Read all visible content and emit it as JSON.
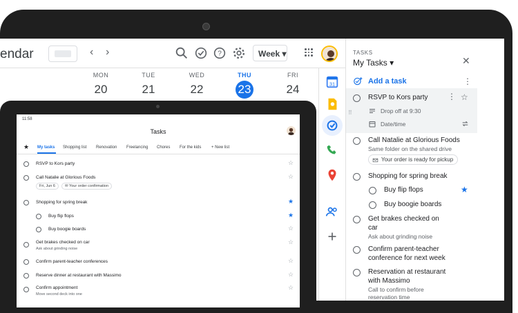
{
  "calendar": {
    "title": "endar",
    "nav_prev": "‹",
    "nav_next": "›",
    "view_select": "Week",
    "days": [
      {
        "name": "MON",
        "date": "20",
        "today": false
      },
      {
        "name": "TUE",
        "date": "21",
        "today": false
      },
      {
        "name": "WED",
        "date": "22",
        "today": false
      },
      {
        "name": "THU",
        "date": "23",
        "today": true
      },
      {
        "name": "FRI",
        "date": "24",
        "today": false
      }
    ]
  },
  "tasks_panel": {
    "label": "TASKS",
    "list_title": "My Tasks ▾",
    "add_task": "Add a task",
    "close": "✕",
    "items": [
      {
        "title": "RSVP to Kors party",
        "detail": "Drop off at 9:30",
        "date_placeholder": "Date/time"
      },
      {
        "title": "Call Natalie at Glorious Foods",
        "detail": "Same folder on the shared drive",
        "chip": "Your order is ready for pickup"
      },
      {
        "title": "Shopping for spring break",
        "subtasks": [
          "Buy flip flops",
          "Buy boogie boards"
        ]
      },
      {
        "title_line1": "Get brakes checked on",
        "title_line2": "car",
        "detail": "Ask about grinding noise"
      },
      {
        "title_line1": "Confirm parent-teacher",
        "title_line2": "conference for next week"
      },
      {
        "title_line1": "Reservation at restaurant",
        "title_line2": "with Massimo",
        "detail": "Call to confirm before",
        "detail2": "reservation time"
      }
    ]
  },
  "tablet": {
    "time": "11:58",
    "title": "Tasks",
    "tabs": [
      "My tasks",
      "Shopping list",
      "Renovation",
      "Freelancing",
      "Chores",
      "For the kids",
      "+ New list"
    ],
    "items": [
      {
        "title": "RSVP to Kors party"
      },
      {
        "title": "Call Natalie at Glorious Foods",
        "chips": [
          "Fri, Jun 6",
          "Your order confirmation"
        ]
      },
      {
        "title": "Shopping for spring break"
      },
      {
        "title": "Buy flip flops"
      },
      {
        "title": "Buy boogie boards"
      },
      {
        "title": "Get brakes checked on car",
        "detail": "Ask about grinding noise"
      },
      {
        "title": "Confirm parent-teacher conferences"
      },
      {
        "title": "Reserve dinner at restaurant with Massimo"
      },
      {
        "title": "Confirm appointment",
        "detail": "Move second deck into one"
      }
    ]
  },
  "colors": {
    "accent": "#1a73e8",
    "bezel": "#1f1f1f",
    "text": "#202124",
    "secondary": "#5f6368"
  }
}
